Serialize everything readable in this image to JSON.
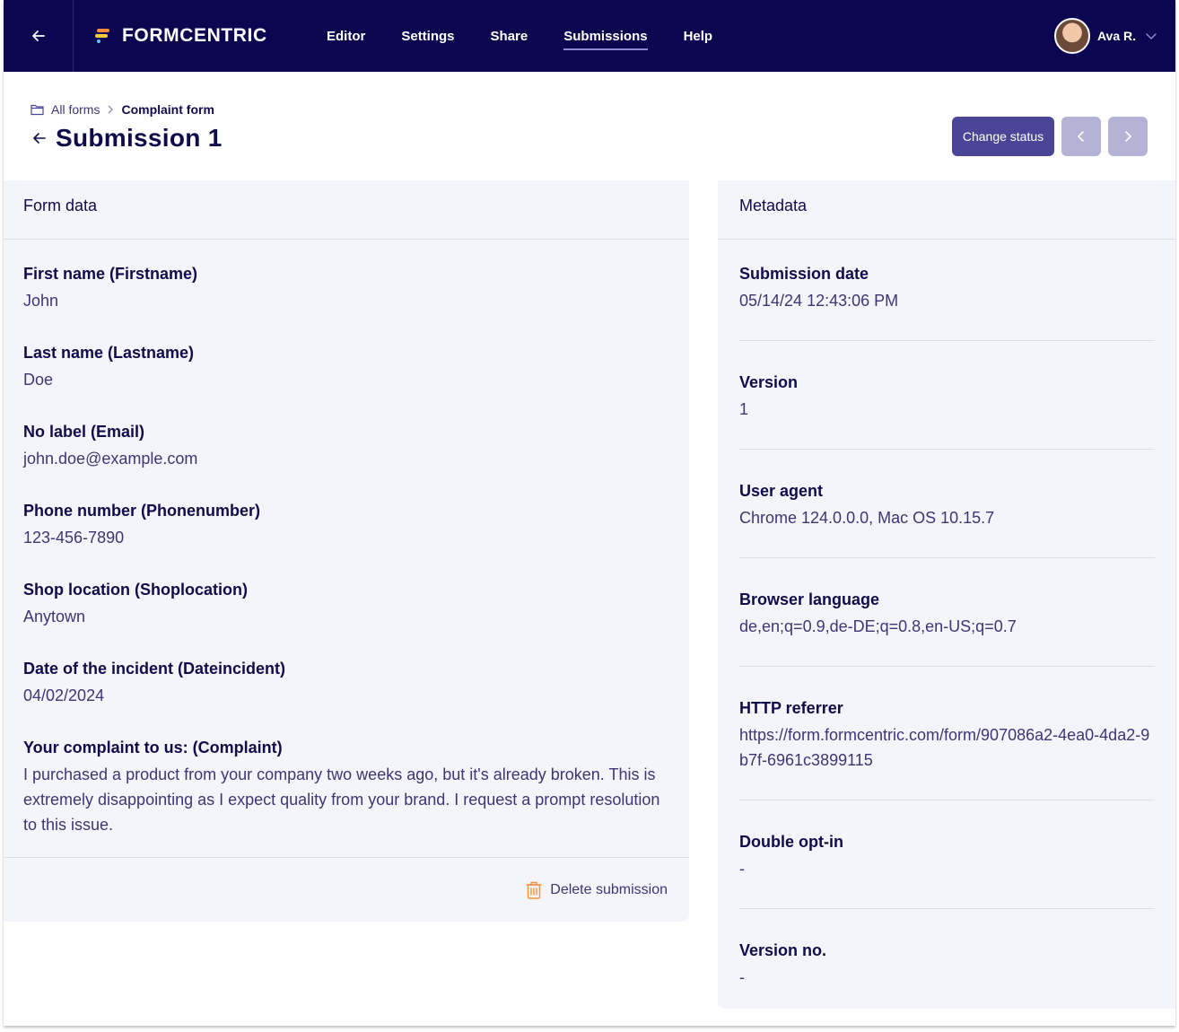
{
  "nav": {
    "brand": "FORMCENTRIC",
    "items": [
      {
        "label": "Editor",
        "active": false
      },
      {
        "label": "Settings",
        "active": false
      },
      {
        "label": "Share",
        "active": false
      },
      {
        "label": "Submissions",
        "active": true
      },
      {
        "label": "Help",
        "active": false
      }
    ],
    "user_name": "Ava R."
  },
  "breadcrumb": {
    "root": "All forms",
    "current": "Complaint form"
  },
  "page_title": "Submission 1",
  "actions": {
    "change_status": "Change status"
  },
  "form_data": {
    "heading": "Form data",
    "fields": [
      {
        "label": "First name (Firstname)",
        "value": "John"
      },
      {
        "label": "Last name (Lastname)",
        "value": "Doe"
      },
      {
        "label": "No label (Email)",
        "value": "john.doe@example.com"
      },
      {
        "label": "Phone number (Phonenumber)",
        "value": "123-456-7890"
      },
      {
        "label": "Shop location (Shoplocation)",
        "value": "Anytown"
      },
      {
        "label": "Date of the incident (Dateincident)",
        "value": "04/02/2024"
      },
      {
        "label": "Your complaint to us: (Complaint)",
        "value": "I purchased a product from your company two weeks ago, but it's already broken. This is extremely disappointing as I expect quality from your brand. I request a prompt resolution to this issue."
      }
    ],
    "delete_label": "Delete submission"
  },
  "metadata": {
    "heading": "Metadata",
    "fields": [
      {
        "label": "Submission date",
        "value": "05/14/24 12:43:06 PM"
      },
      {
        "label": "Version",
        "value": "1"
      },
      {
        "label": "User agent",
        "value": "Chrome 124.0.0.0, Mac OS 10.15.7"
      },
      {
        "label": "Browser language",
        "value": "de,en;q=0.9,de-DE;q=0.8,en-US;q=0.7"
      },
      {
        "label": "HTTP referrer",
        "value": "https://form.formcentric.com/form/907086a2-4ea0-4da2-9b7f-6961c3899115"
      },
      {
        "label": "Double opt-in",
        "value": "-"
      },
      {
        "label": "Version no.",
        "value": "-"
      }
    ]
  },
  "colors": {
    "nav_bg": "#0c0650",
    "primary": "#4b4597",
    "pager": "#b4b3d5",
    "panel_bg": "#f4f5fa",
    "delete_icon": "#f0943a"
  }
}
